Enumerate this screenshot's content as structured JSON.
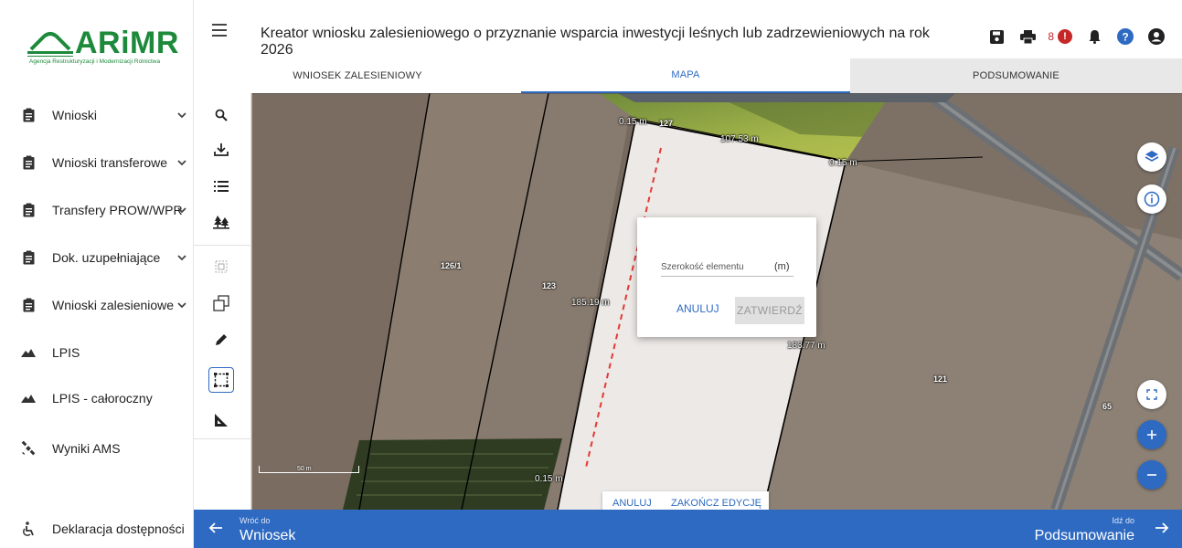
{
  "app": {
    "logo_text": "ARiMR",
    "logo_subtitle": "Agencja Restrukturyzacji i Modernizacji Rolnictwa",
    "title": "Kreator wniosku zalesieniowego o przyznanie wsparcia inwestycji leśnych lub zadrzewieniowych na rok 2026",
    "notification_count": "8"
  },
  "sidebar": {
    "items": [
      {
        "label": "Wnioski",
        "icon": "clipboard-icon",
        "has_chevron": true
      },
      {
        "label": "Wnioski transferowe",
        "icon": "clipboard-icon",
        "has_chevron": true
      },
      {
        "label": "Transfery PROW/WPR",
        "icon": "clipboard-icon",
        "has_chevron": true
      },
      {
        "label": "Dok. uzupełniające",
        "icon": "clipboard-icon",
        "has_chevron": true
      },
      {
        "label": "Wnioski zalesieniowe",
        "icon": "clipboard-icon",
        "has_chevron": true
      },
      {
        "label": "LPIS",
        "icon": "mountain-icon",
        "has_chevron": false
      },
      {
        "label": "LPIS - całoroczny",
        "icon": "mountain-icon",
        "has_chevron": false
      },
      {
        "label": "Wyniki AMS",
        "icon": "satellite-icon",
        "has_chevron": false
      }
    ],
    "accessibility_label": "Deklaracja dostępności"
  },
  "tabs": [
    {
      "label": "WNIOSEK ZALESIENIOWY",
      "active": false
    },
    {
      "label": "MAPA",
      "active": true
    },
    {
      "label": "PODSUMOWANIE",
      "active": false
    }
  ],
  "map": {
    "parcel_labels": [
      "127",
      "126/1",
      "123",
      "121",
      "65"
    ],
    "measurements": [
      "0.15 m",
      "107.53 m",
      "0.15 m",
      "185.19 m",
      "183.77 m",
      "0.15 m"
    ],
    "scale_label": "50 m"
  },
  "dialog": {
    "field_label": "Szerokość elementu",
    "unit": "(m)",
    "cancel_label": "ANULUJ",
    "confirm_label": "ZATWIERDŹ"
  },
  "editbar": {
    "cancel_label": "ANULUJ",
    "finish_label": "ZAKOŃCZ EDYCJĘ"
  },
  "footer": {
    "back_small": "Wróć do",
    "back_big": "Wniosek",
    "next_small": "Idź do",
    "next_big": "Podsumowanie"
  },
  "colors": {
    "accent": "#2e6ac2",
    "brand": "#1d8a3b",
    "alert": "#c62828"
  }
}
